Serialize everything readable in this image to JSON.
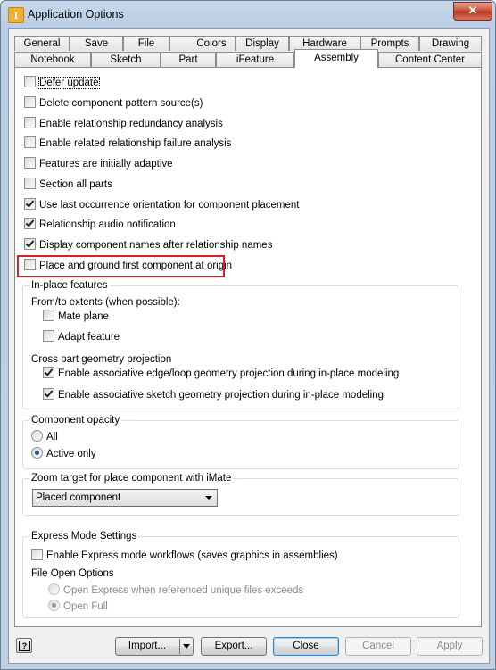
{
  "window": {
    "title": "Application Options",
    "close_glyph": "✕",
    "app_icon_letter": "I"
  },
  "tabs_row1": [
    "General",
    "Save",
    "File",
    "Colors",
    "Display",
    "Hardware",
    "Prompts",
    "Drawing"
  ],
  "tabs_row2": [
    "Notebook",
    "Sketch",
    "Part",
    "iFeature",
    "Assembly",
    "Content Center"
  ],
  "active_tab": "Assembly",
  "options": [
    {
      "label": "Defer update",
      "checked": false
    },
    {
      "label": "Delete component pattern source(s)",
      "checked": false
    },
    {
      "label": "Enable relationship redundancy analysis",
      "checked": false
    },
    {
      "label": "Enable related relationship failure analysis",
      "checked": false
    },
    {
      "label": "Features are initially adaptive",
      "checked": false
    },
    {
      "label": "Section all parts",
      "checked": false
    },
    {
      "label": "Use last occurrence orientation for component placement",
      "checked": true
    },
    {
      "label": "Relationship audio notification",
      "checked": true
    },
    {
      "label": "Display component names after relationship names",
      "checked": true
    },
    {
      "label": "Place and ground first component at origin",
      "checked": false
    }
  ],
  "inplace": {
    "title": "In-place features",
    "extents_label": "From/to extents (when possible):",
    "mate_plane": {
      "label": "Mate plane",
      "checked": false
    },
    "adapt_feature": {
      "label": "Adapt feature",
      "checked": false
    },
    "projection_label": "Cross part geometry projection",
    "edge_loop": {
      "label": "Enable associative edge/loop geometry projection during in-place modeling",
      "checked": true
    },
    "sketch_geom": {
      "label": "Enable associative sketch geometry projection during in-place modeling",
      "checked": true
    }
  },
  "opacity": {
    "title": "Component opacity",
    "all": {
      "label": "All",
      "selected": false
    },
    "active_only": {
      "label": "Active only",
      "selected": true
    }
  },
  "zoom": {
    "title": "Zoom target for place component with iMate",
    "selected": "Placed component"
  },
  "express": {
    "title": "Express Mode Settings",
    "enable": {
      "label": "Enable Express mode workflows (saves graphics in assemblies)",
      "checked": false
    },
    "file_open_label": "File Open Options",
    "open_express": {
      "label": "Open Express when referenced unique files exceeds",
      "selected": false
    },
    "open_full": {
      "label": "Open Full",
      "selected": true
    }
  },
  "buttons": {
    "help": "?",
    "import": "Import...",
    "export": "Export...",
    "close": "Close",
    "cancel": "Cancel",
    "apply": "Apply"
  }
}
